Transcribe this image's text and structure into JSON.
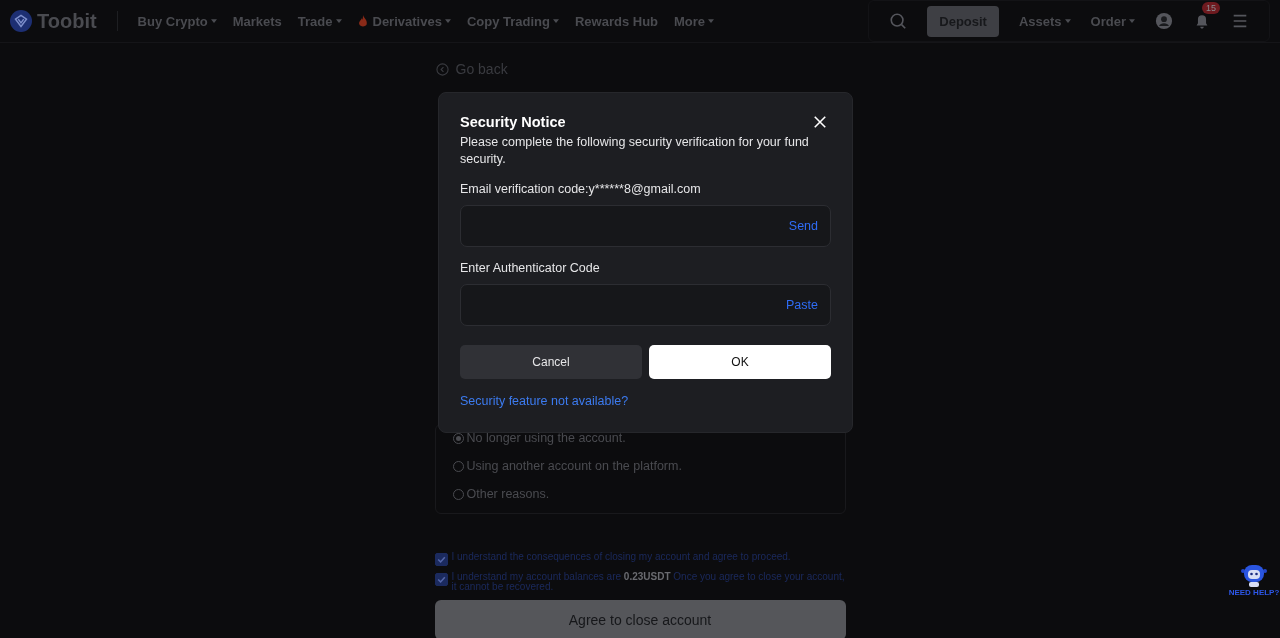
{
  "nav": {
    "brand": "Toobit",
    "items": [
      {
        "label": "Buy Crypto",
        "dropdown": true,
        "hot": false
      },
      {
        "label": "Markets",
        "dropdown": false,
        "hot": false
      },
      {
        "label": "Trade",
        "dropdown": true,
        "hot": false
      },
      {
        "label": "Derivatives",
        "dropdown": true,
        "hot": true
      },
      {
        "label": "Copy Trading",
        "dropdown": true,
        "hot": false
      },
      {
        "label": "Rewards Hub",
        "dropdown": false,
        "hot": false
      },
      {
        "label": "More",
        "dropdown": true,
        "hot": false
      }
    ],
    "deposit": "Deposit",
    "menus": [
      {
        "label": "Assets"
      },
      {
        "label": "Order"
      }
    ],
    "notification_count": "15"
  },
  "page": {
    "go_back": "Go back",
    "reasons": [
      {
        "label": "No longer using the account.",
        "selected": true
      },
      {
        "label": "Using another account on the platform.",
        "selected": false
      },
      {
        "label": "Other reasons.",
        "selected": false
      }
    ],
    "agreements": [
      {
        "text": "I understand the consequences of closing my account and agree to proceed.",
        "checked": true
      },
      {
        "text": "I understand my account balances are **0.23USDT** Once you agree to close your account, it cannot be recovered.",
        "checked": true
      }
    ],
    "submit": "Agree to close account"
  },
  "dialog": {
    "title": "Security Notice",
    "description": "Please complete the following security verification for your fund security.",
    "fields": [
      {
        "label": "Email verification code:y******8@gmail.com",
        "action": "Send"
      },
      {
        "label": "Enter Authenticator Code",
        "action": "Paste"
      }
    ],
    "buttons": [
      {
        "label": "Cancel",
        "kind": "secondary"
      },
      {
        "label": "OK",
        "kind": "primary"
      }
    ],
    "help_link": "Security feature not available?"
  },
  "help_widget": {
    "label": "NEED HELP?"
  }
}
